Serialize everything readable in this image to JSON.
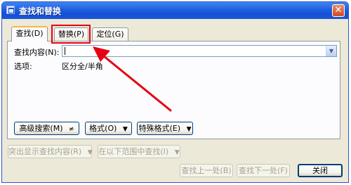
{
  "window": {
    "title": "查找和替换",
    "close_glyph": "✕"
  },
  "tabs": [
    {
      "label": "查找(D)"
    },
    {
      "label": "替换(P)"
    },
    {
      "label": "定位(G)"
    }
  ],
  "find": {
    "label": "查找内容(N):",
    "value": ""
  },
  "options": {
    "label": "选项:",
    "value": "区分全/半角"
  },
  "buttons": {
    "more": "高级搜索(M)",
    "more_arrows": "≠",
    "format": "格式(O)",
    "special": "特殊格式(E)",
    "highlight": "突出显示查找内容(R)",
    "find_in": "在以下范围中查找(I)",
    "find_prev": "查找上一处(B)",
    "find_next": "查找下一处(F)",
    "close": "关闭"
  },
  "annotation": {
    "color": "#e60012"
  }
}
